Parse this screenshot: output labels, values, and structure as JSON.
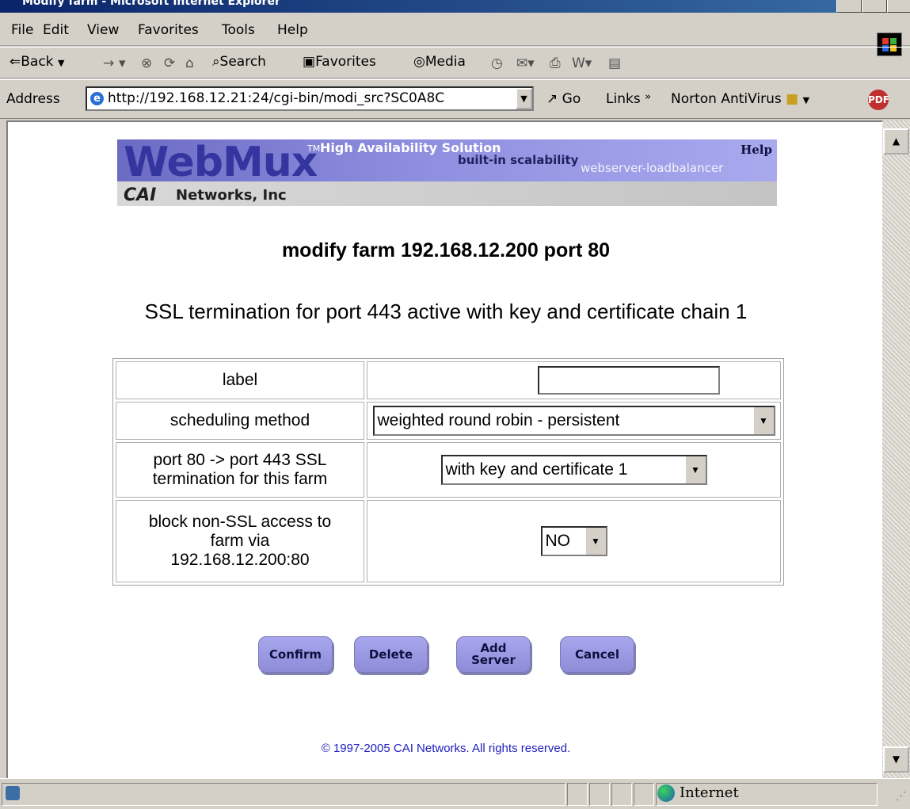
{
  "window": {
    "title": "Modify farm - Microsoft Internet Explorer"
  },
  "menu": {
    "file": "File",
    "edit": "Edit",
    "view": "View",
    "favorites": "Favorites",
    "tools": "Tools",
    "help": "Help"
  },
  "toolbar": {
    "back": "Back",
    "search": "Search",
    "favorites": "Favorites",
    "media": "Media"
  },
  "address": {
    "label": "Address",
    "url": "http://192.168.12.21:24/cgi-bin/modi_src?SC0A8C",
    "go": "Go",
    "links": "Links",
    "norton": "Norton AntiVirus"
  },
  "banner": {
    "logo": "WebMux",
    "tm": "TM",
    "tagline": "High Availability Solution",
    "builtin": "built-in scalability",
    "sub": "webserver-loadbalancer",
    "help": "Help",
    "company_logo": "CAI",
    "company": "Networks, Inc"
  },
  "page": {
    "title": "modify farm 192.168.12.200 port 80",
    "ssl_status": "SSL termination for port 443 active with key and certificate chain 1"
  },
  "form": {
    "label_label": "label",
    "label_value": "",
    "scheduling_label": "scheduling method",
    "scheduling_value": "weighted round robin - persistent",
    "ssl_label_line1": "port 80 -> port 443 SSL",
    "ssl_label_line2": "termination for this farm",
    "ssl_value": "with key and certificate 1",
    "block_label_line1": "block non-SSL access to",
    "block_label_line2": "farm via",
    "block_label_line3": "192.168.12.200:80",
    "block_value": "NO"
  },
  "buttons": {
    "confirm": "Confirm",
    "delete": "Delete",
    "add_server_line1": "Add",
    "add_server_line2": "Server",
    "cancel": "Cancel"
  },
  "footer": {
    "copyright": "© 1997-2005 CAI Networks. All rights reserved."
  },
  "status": {
    "zone": "Internet"
  }
}
